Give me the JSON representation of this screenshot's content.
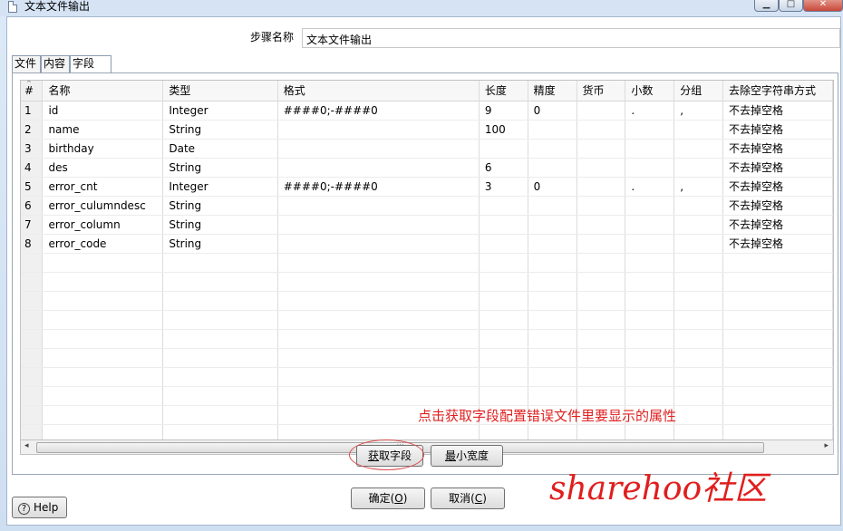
{
  "window": {
    "title": "文本文件输出"
  },
  "window_controls": {
    "min": "▁",
    "max": "□",
    "close": "✕"
  },
  "step_name": {
    "label": "步骤名称",
    "value": "文本文件输出"
  },
  "tabs": [
    {
      "label": "文件"
    },
    {
      "label": "内容"
    },
    {
      "label": "字段"
    }
  ],
  "table": {
    "sort_marker": "^",
    "columns": [
      "#",
      "名称",
      "类型",
      "格式",
      "长度",
      "精度",
      "货币",
      "小数",
      "分组",
      "去除空字符串方式"
    ],
    "rows": [
      [
        "1",
        "id",
        "Integer",
        "####0;-####0",
        "9",
        "0",
        "",
        ".",
        ",",
        "不去掉空格"
      ],
      [
        "2",
        "name",
        "String",
        "",
        "100",
        "",
        "",
        "",
        "",
        "不去掉空格"
      ],
      [
        "3",
        "birthday",
        "Date",
        "",
        "",
        "",
        "",
        "",
        "",
        "不去掉空格"
      ],
      [
        "4",
        "des",
        "String",
        "",
        "6",
        "",
        "",
        "",
        "",
        "不去掉空格"
      ],
      [
        "5",
        "error_cnt",
        "Integer",
        "####0;-####0",
        "3",
        "0",
        "",
        ".",
        ",",
        "不去掉空格"
      ],
      [
        "6",
        "error_culumndesc",
        "String",
        "",
        "",
        "",
        "",
        "",
        "",
        "不去掉空格"
      ],
      [
        "7",
        "error_column",
        "String",
        "",
        "",
        "",
        "",
        "",
        "",
        "不去掉空格"
      ],
      [
        "8",
        "error_code",
        "String",
        "",
        "",
        "",
        "",
        "",
        "",
        "不去掉空格"
      ]
    ],
    "empty_rows": 10
  },
  "scrollbar": {
    "left_arrow": "◂",
    "right_arrow": "▸",
    "thumb_grip": "|||"
  },
  "annotation": "点击获取字段配置错误文件里要显示的属性",
  "buttons": {
    "get_fields": {
      "text": "获取字段",
      "mnemonic": "获"
    },
    "min_width": {
      "text": "最小宽度",
      "mnemonic": "最"
    },
    "ok": {
      "label": "确定(",
      "mnemonic": "O",
      "suffix": ")"
    },
    "cancel": {
      "label": "取消(",
      "mnemonic": "C",
      "suffix": ")"
    },
    "help": {
      "label": "Help",
      "icon": "?"
    }
  },
  "watermark": "sharehoo社区"
}
